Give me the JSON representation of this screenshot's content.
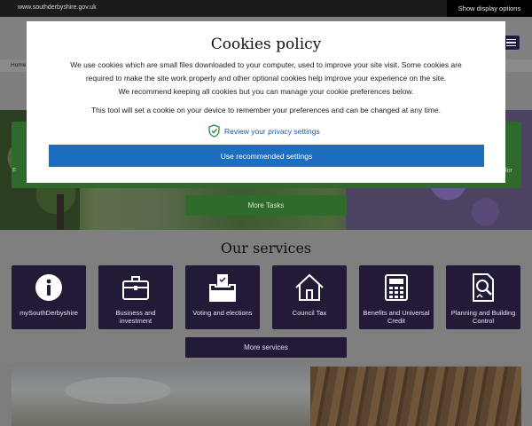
{
  "topbar": {
    "url": "www.southderbyshire.gov.uk",
    "display_options": "Show display options"
  },
  "breadcrumb": {
    "home": "Home"
  },
  "hero": {
    "side_left": "F",
    "side_right": "lor",
    "more_tasks": "More Tasks"
  },
  "services": {
    "title": "Our services",
    "tiles": [
      {
        "label": "mySouthDerbyshire",
        "icon": "info-icon"
      },
      {
        "label": "Business and investment",
        "icon": "briefcase-icon"
      },
      {
        "label": "Voting and elections",
        "icon": "ballot-box-icon"
      },
      {
        "label": "Council Tax",
        "icon": "house-icon"
      },
      {
        "label": "Benefits and Universal Credit",
        "icon": "calculator-icon"
      },
      {
        "label": "Planning and Building Control",
        "icon": "document-search-icon"
      }
    ],
    "more_services": "More services"
  },
  "cookie_modal": {
    "title": "Cookies policy",
    "paragraph1_line1": "We use cookies which are small files downloaded to your computer, used to improve your site visit. Some cookies are",
    "paragraph1_line2": "required to make the site work properly and other optional cookies help improve your experience on the site.",
    "paragraph1_line3": "We recommend keeping all cookies but you can manage your cookie preferences below.",
    "paragraph2": "This tool will set a cookie on your device to remember your preferences and can be changed at any time.",
    "review_link": "Review your privacy settings",
    "use_recommended": "Use recommended settings"
  },
  "colors": {
    "primary_button": "#1e6ec0",
    "service_tile": "#231a37",
    "task_green": "#2f6b2b",
    "link": "#1b5aa6",
    "shield_green": "#2e8b3a"
  }
}
